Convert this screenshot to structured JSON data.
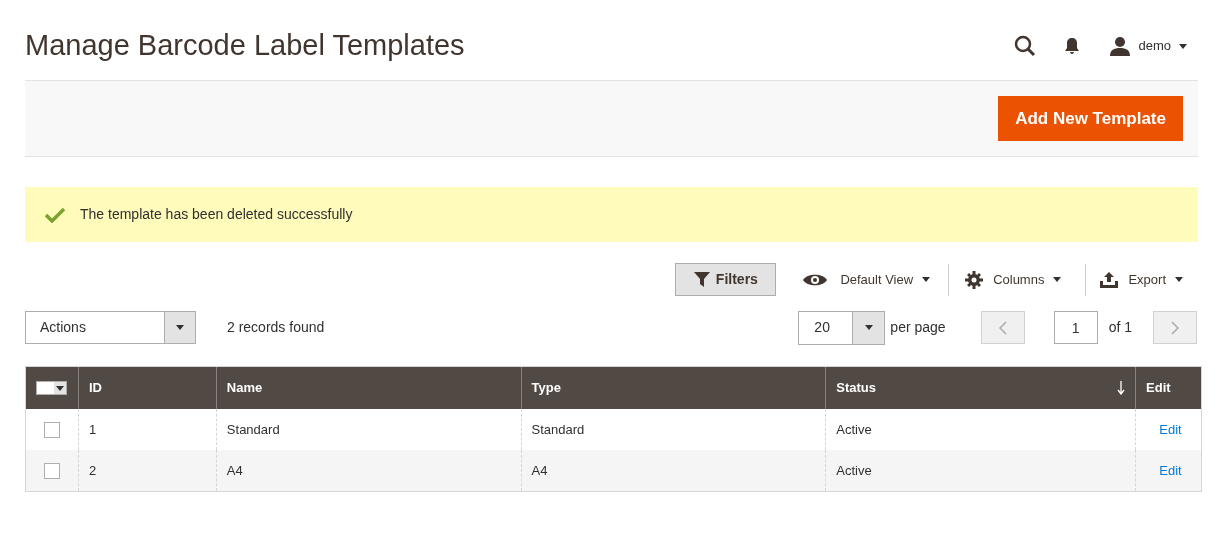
{
  "page_title": "Manage Barcode Label Templates",
  "header": {
    "user": "demo"
  },
  "primary_button": "Add New Template",
  "message": {
    "kind": "success",
    "text": "The template has been deleted successfully"
  },
  "toolbar": {
    "filters": "Filters",
    "view": "Default View",
    "columns": "Columns",
    "export": "Export"
  },
  "actions": {
    "value": "Actions"
  },
  "records": "2 records found",
  "pager": {
    "per_page_value": "20",
    "per_page_label": "per page",
    "page": "1",
    "of": "of 1"
  },
  "table": {
    "columns": [
      {
        "label": "ID",
        "sorted": false
      },
      {
        "label": "Name",
        "sorted": false
      },
      {
        "label": "Type",
        "sorted": false
      },
      {
        "label": "Status",
        "sorted": true
      },
      {
        "label": "Edit",
        "sorted": false
      }
    ],
    "rows": [
      {
        "checked": false,
        "cells": [
          "1",
          "Standard",
          "Standard",
          "Active"
        ],
        "action": "Edit"
      },
      {
        "checked": false,
        "cells": [
          "2",
          "A4",
          "A4",
          "Active"
        ],
        "action": "Edit"
      }
    ]
  }
}
